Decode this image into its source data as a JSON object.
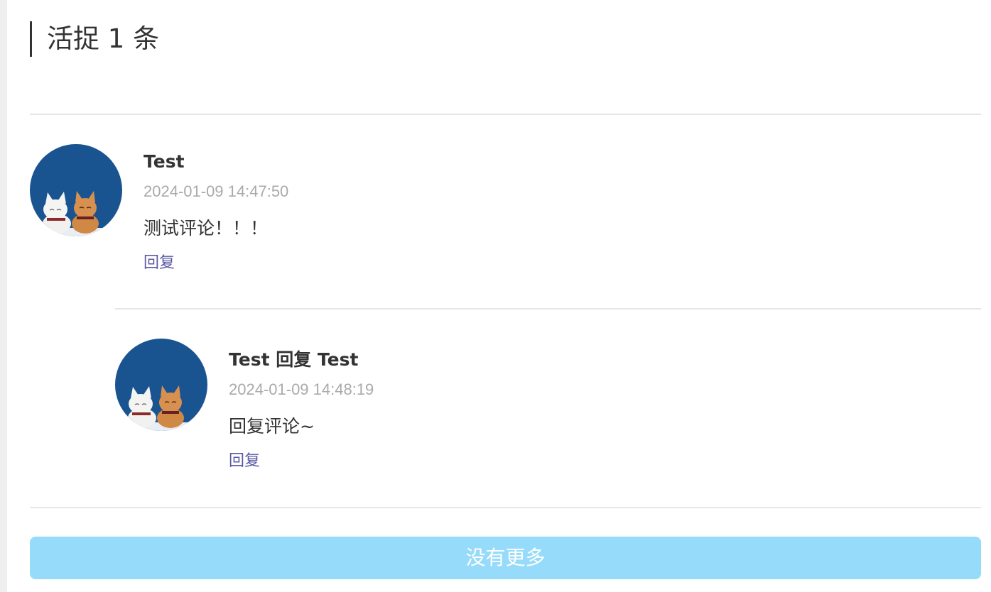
{
  "header": {
    "title": "活捉 1 条"
  },
  "comments": [
    {
      "author": "Test",
      "time": "2024-01-09 14:47:50",
      "content": "测试评论！！！",
      "reply_label": "回复",
      "avatar_icon": "cats-avatar-icon"
    },
    {
      "author": "Test 回复 Test",
      "time": "2024-01-09 14:48:19",
      "content": "回复评论~",
      "reply_label": "回复",
      "avatar_icon": "cats-avatar-icon"
    }
  ],
  "footer": {
    "more_label": "没有更多"
  },
  "colors": {
    "accent_link": "#5a5aa5",
    "button_bg": "#96dcfa",
    "avatar_bg": "#1a5490",
    "timestamp": "#aaaaaa"
  }
}
